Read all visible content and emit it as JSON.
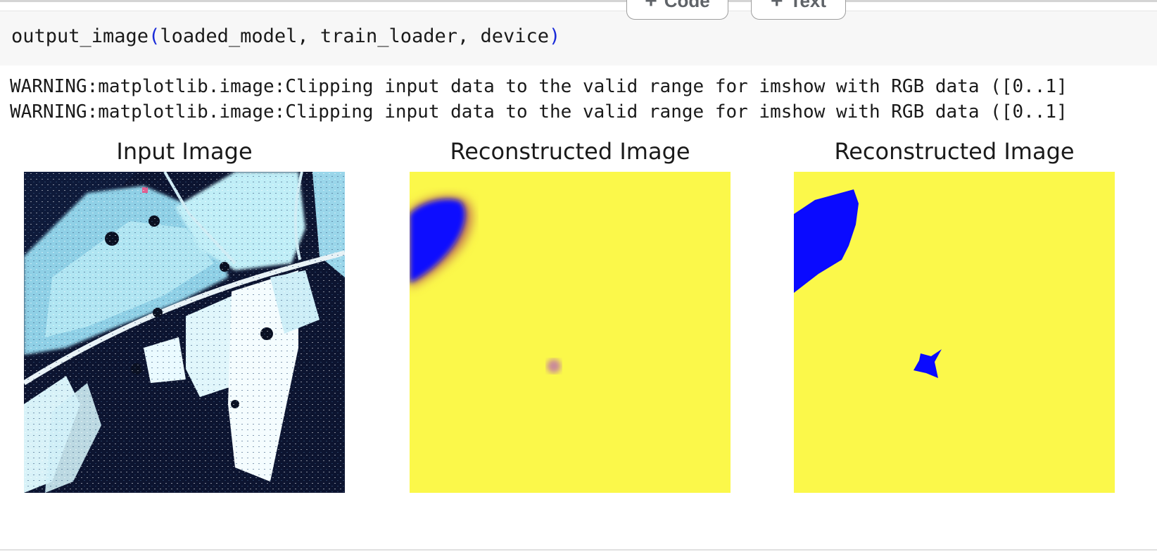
{
  "toolbar": {
    "add_code_label": "Code",
    "add_text_label": "Text"
  },
  "code_cell": {
    "fn_name": "output_image",
    "open_paren": "(",
    "args": "loaded_model, train_loader, device",
    "close_paren": ")"
  },
  "output": {
    "warnings": [
      "WARNING:matplotlib.image:Clipping input data to the valid range for imshow with RGB data ([0..1]",
      "WARNING:matplotlib.image:Clipping input data to the valid range for imshow with RGB data ([0..1]"
    ],
    "panels": [
      {
        "title": "Input Image"
      },
      {
        "title": "Reconstructed Image"
      },
      {
        "title": "Reconstructed Image"
      }
    ]
  },
  "colors": {
    "yellow": "#fbf84a",
    "blue": "#0a0aff",
    "paren": "#1a2bd8"
  }
}
